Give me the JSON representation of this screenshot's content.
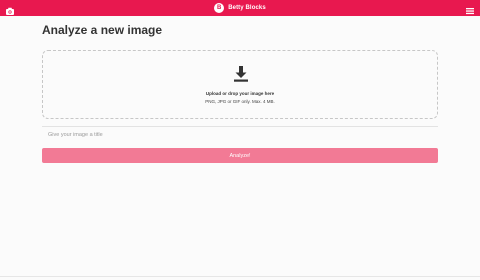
{
  "header": {
    "brand_name": "Betty Blocks",
    "brand_letter": "B",
    "background_color": "#e8184f",
    "icons": {
      "left": "camera-icon",
      "right": "hamburger-menu-icon"
    }
  },
  "page": {
    "title": "Analyze a new image"
  },
  "upload": {
    "icon": "download-icon",
    "title": "Upload or drop your image here",
    "note": "PNG, JPG or GIF only. Max. 4 MB."
  },
  "title_field": {
    "placeholder": "Give your image a title",
    "value": ""
  },
  "analyze_button": {
    "label": "Analyze!",
    "color": "#f27a95"
  }
}
